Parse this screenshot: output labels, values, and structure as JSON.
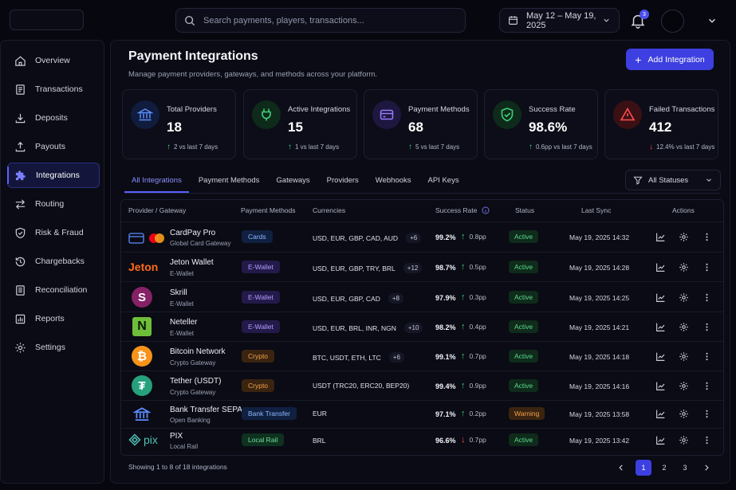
{
  "header": {
    "search_placeholder": "Search payments, players, transactions...",
    "date_range": "May 12 – May 19, 2025",
    "notification_count": "3"
  },
  "sidebar": {
    "items": [
      {
        "label": "Overview",
        "icon": "home-icon"
      },
      {
        "label": "Transactions",
        "icon": "receipt-icon"
      },
      {
        "label": "Deposits",
        "icon": "download-icon"
      },
      {
        "label": "Payouts",
        "icon": "upload-icon"
      },
      {
        "label": "Integrations",
        "icon": "puzzle-icon",
        "active": true
      },
      {
        "label": "Routing",
        "icon": "routing-arrows-icon"
      },
      {
        "label": "Risk & Fraud",
        "icon": "shield-check-icon"
      },
      {
        "label": "Chargebacks",
        "icon": "history-icon"
      },
      {
        "label": "Reconciliation",
        "icon": "document-icon"
      },
      {
        "label": "Reports",
        "icon": "report-icon"
      },
      {
        "label": "Settings",
        "icon": "gear-icon"
      }
    ]
  },
  "page": {
    "title": "Payment Integrations",
    "subtitle": "Manage payment providers, gateways, and methods across your platform.",
    "add_button": "Add Integration"
  },
  "stats": [
    {
      "label": "Total Providers",
      "value": "18",
      "delta": "2 vs last 7 days",
      "direction": "up",
      "icon": "bank-icon",
      "color": "#5b8dff"
    },
    {
      "label": "Active Integrations",
      "value": "15",
      "delta": "1 vs last 7 days",
      "direction": "up",
      "icon": "plug-icon",
      "color": "#3ed07a"
    },
    {
      "label": "Payment Methods",
      "value": "68",
      "delta": "5 vs last 7 days",
      "direction": "up",
      "icon": "card-icon",
      "color": "#9b7bff"
    },
    {
      "label": "Success Rate",
      "value": "98.6%",
      "delta": "0.6pp vs last 7 days",
      "direction": "up",
      "icon": "shield-check-icon",
      "color": "#3ed07a"
    },
    {
      "label": "Failed Transactions",
      "value": "412",
      "delta": "12.4% vs last 7 days",
      "direction": "down",
      "icon": "warning-icon",
      "color": "#ff4d4d"
    }
  ],
  "tabs": [
    "All Integrations",
    "Payment Methods",
    "Gateways",
    "Providers",
    "Webhooks",
    "API Keys"
  ],
  "active_tab": 0,
  "status_filter": "All Statuses",
  "table": {
    "columns": [
      "Provider / Gateway",
      "Payment Methods",
      "Currencies",
      "Success Rate",
      "Status",
      "Last Sync",
      "Actions"
    ],
    "rows": [
      {
        "name": "CardPay Pro",
        "sub": "Global Card Gateway",
        "logo": "cardpay-logo",
        "method": "Cards",
        "method_kind": "card",
        "currencies": "USD, EUR, GBP, CAD, AUD",
        "more": "+6",
        "rate": "99.2%",
        "delta": "0.8pp",
        "dir": "up",
        "status": "Active",
        "status_kind": "active",
        "sync": "May 19, 2025 14:32"
      },
      {
        "name": "Jeton Wallet",
        "sub": "E-Wallet",
        "logo": "jeton-logo",
        "logo_text": "Jeton",
        "method": "E-Wallet",
        "method_kind": "wallet",
        "currencies": "USD, EUR, GBP, TRY, BRL",
        "more": "+12",
        "rate": "98.7%",
        "delta": "0.5pp",
        "dir": "up",
        "status": "Active",
        "status_kind": "active",
        "sync": "May 19, 2025 14:28"
      },
      {
        "name": "Skrill",
        "sub": "E-Wallet",
        "logo": "skrill-logo",
        "logo_text": "S",
        "method": "E-Wallet",
        "method_kind": "wallet",
        "currencies": "USD, EUR, GBP, CAD",
        "more": "+8",
        "rate": "97.9%",
        "delta": "0.3pp",
        "dir": "up",
        "status": "Active",
        "status_kind": "active",
        "sync": "May 19, 2025 14:25"
      },
      {
        "name": "Neteller",
        "sub": "E-Wallet",
        "logo": "neteller-logo",
        "logo_text": "N",
        "method": "E-Wallet",
        "method_kind": "wallet",
        "currencies": "USD, EUR, BRL, INR, NGN",
        "more": "+10",
        "rate": "98.2%",
        "delta": "0.4pp",
        "dir": "up",
        "status": "Active",
        "status_kind": "active",
        "sync": "May 19, 2025 14:21"
      },
      {
        "name": "Bitcoin Network",
        "sub": "Crypto Gateway",
        "logo": "bitcoin-logo",
        "logo_text": "₿",
        "method": "Crypto",
        "method_kind": "crypto",
        "currencies": "BTC, USDT, ETH, LTC",
        "more": "+6",
        "rate": "99.1%",
        "delta": "0.7pp",
        "dir": "up",
        "status": "Active",
        "status_kind": "active",
        "sync": "May 19, 2025 14:18"
      },
      {
        "name": "Tether (USDT)",
        "sub": "Crypto Gateway",
        "logo": "tether-logo",
        "logo_text": "₮",
        "method": "Crypto",
        "method_kind": "crypto",
        "currencies": "USDT (TRC20, ERC20, BEP20)",
        "more": "",
        "rate": "99.4%",
        "delta": "0.9pp",
        "dir": "up",
        "status": "Active",
        "status_kind": "active",
        "sync": "May 19, 2025 14:16"
      },
      {
        "name": "Bank Transfer SEPA",
        "sub": "Open Banking",
        "logo": "bank-logo",
        "method": "Bank Transfer",
        "method_kind": "bank",
        "currencies": "EUR",
        "more": "",
        "rate": "97.1%",
        "delta": "0.2pp",
        "dir": "up",
        "status": "Warning",
        "status_kind": "warning",
        "sync": "May 19, 2025 13:58"
      },
      {
        "name": "PIX",
        "sub": "Local Rail",
        "logo": "pix-logo",
        "logo_text": "pix",
        "method": "Local Rail",
        "method_kind": "local",
        "currencies": "BRL",
        "more": "",
        "rate": "96.6%",
        "delta": "0.7pp",
        "dir": "down",
        "status": "Active",
        "status_kind": "active",
        "sync": "May 19, 2025 13:42"
      }
    ]
  },
  "pagination": {
    "showing": "Showing 1 to 8 of 18 integrations",
    "pages": [
      "1",
      "2",
      "3"
    ],
    "current": "1"
  },
  "colors": {
    "accent": "#3d3fe0",
    "up": "#3ed07a",
    "down": "#ff4d4d"
  }
}
